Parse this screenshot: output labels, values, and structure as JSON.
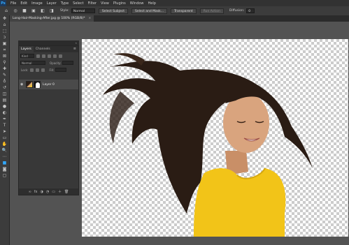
{
  "app": {
    "logo": "Ps"
  },
  "menu": [
    "File",
    "Edit",
    "Image",
    "Layer",
    "Type",
    "Select",
    "Filter",
    "View",
    "Plugins",
    "Window",
    "Help"
  ],
  "options": {
    "feather_label": "Feather:",
    "style_label": "Style:",
    "style_value": "Normal",
    "buttons": [
      "Select Subject",
      "Select and Mask...",
      "Transparent",
      "Run Action"
    ],
    "brush_label": "Diffusion:",
    "brush_value": "0"
  },
  "document": {
    "tab_title": "Long-Hair-Masking-After.jpg @ 100% (RGB/8)*",
    "close": "×"
  },
  "tools": [
    "move-tool-icon",
    "artboard-tool-icon",
    "marquee-tool-icon",
    "lasso-tool-icon",
    "object-select-tool-icon",
    "crop-tool-icon",
    "frame-tool-icon",
    "eyedropper-tool-icon",
    "healing-brush-icon",
    "brush-tool-icon",
    "clone-stamp-icon",
    "history-brush-icon",
    "eraser-tool-icon",
    "gradient-tool-icon",
    "blur-tool-icon",
    "dodge-tool-icon",
    "pen-tool-icon",
    "type-tool-icon",
    "path-select-icon",
    "shape-tool-icon",
    "hand-tool-icon",
    "zoom-tool-icon",
    "more-tools-icon",
    "foreground-color-icon",
    "quick-mask-icon",
    "screen-mode-icon"
  ],
  "tool_glyphs": [
    "✥",
    "⌂",
    "⬚",
    "ↄ",
    "▣",
    "⌗",
    "⊠",
    "⚲",
    "✚",
    "✎",
    "♁",
    "↺",
    "◫",
    "▤",
    "●",
    "◐",
    "✒",
    "T",
    "➤",
    "▭",
    "✋",
    "🔍",
    "⋯",
    "■",
    "◙",
    "▢"
  ],
  "layers_panel": {
    "tabs": [
      "Layers",
      "Channels"
    ],
    "menu_glyph": "≡",
    "collapse_glyph": "«",
    "filter_value": "Kind",
    "blend_mode": "Normal",
    "opacity_label": "Opacity:",
    "lock_label": "Lock:",
    "fill_label": "Fill:",
    "layers": [
      {
        "name": "Layer 0",
        "visible_glyph": "◉"
      }
    ],
    "footer_icons": [
      "∞",
      "fx",
      "◑",
      "◔",
      "▭",
      "＋",
      "🗑"
    ]
  },
  "colors": {
    "accent": "#31a8ff",
    "shirt": "#f2c418",
    "hair": "#2a1c14",
    "skin": "#d9a47e"
  }
}
